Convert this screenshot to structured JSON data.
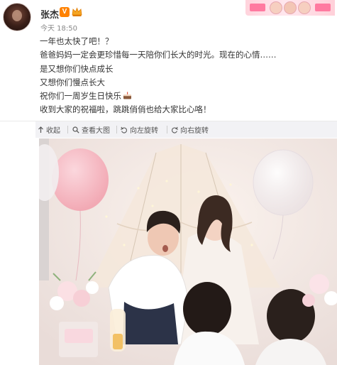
{
  "post": {
    "author": "张杰",
    "verified_badge": "V",
    "time": "今天 18:50",
    "lines": [
      "一年也太快了吧！？",
      "爸爸妈妈一定会更珍惜每一天陪你们长大的时光。现在的心情……",
      "是又想你们快点成长",
      "又想你们慢点长大",
      "祝你们一周岁生日快乐",
      "收到大家的祝福啦，跳跳俏俏也给大家比心咯！"
    ]
  },
  "toolbar": {
    "collapse_label": "收起",
    "view_large_label": "查看大图",
    "rotate_left_label": "向左旋转",
    "rotate_right_label": "向右旋转"
  },
  "icons": {
    "crown": "crown-icon",
    "cake": "cake-icon",
    "collapse": "arrow-up-icon",
    "view_large": "magnifier-icon",
    "rotate_left": "rotate-left-icon",
    "rotate_right": "rotate-right-icon"
  },
  "colors": {
    "verified_orange": "#ff8200",
    "toolbar_bg": "#f2f2f5",
    "text": "#333333",
    "muted": "#888888"
  }
}
